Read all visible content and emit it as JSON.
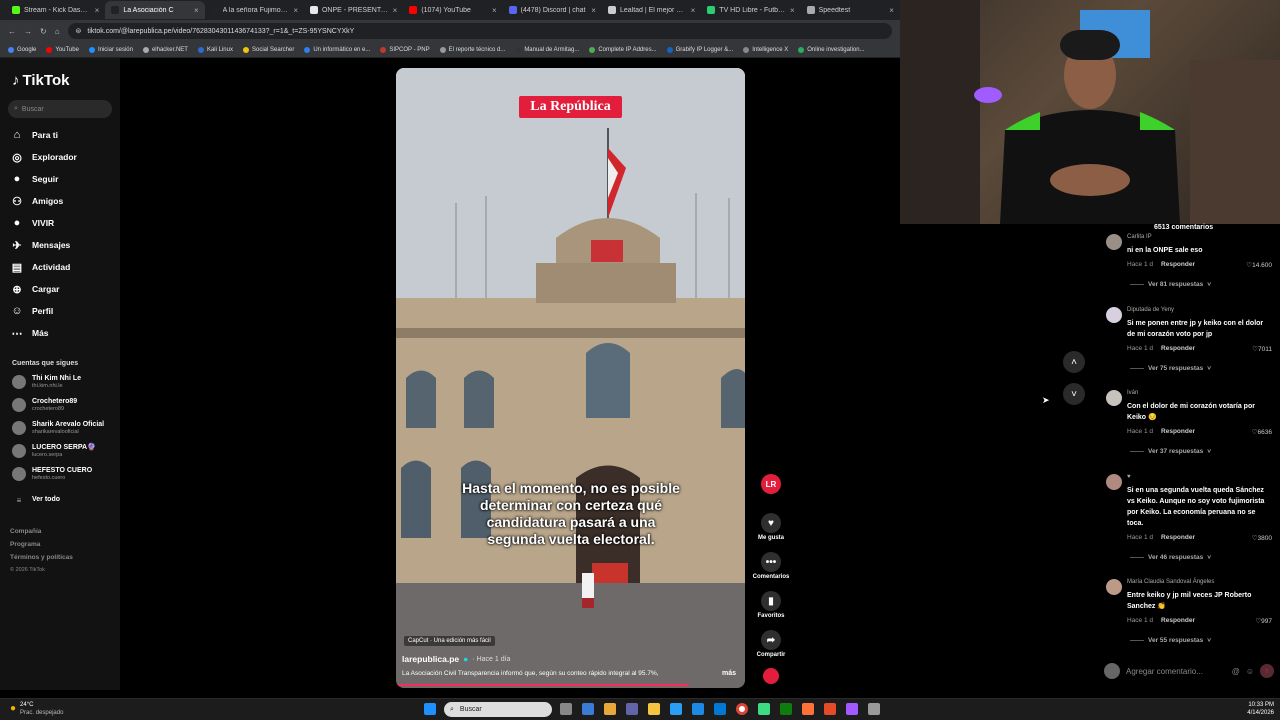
{
  "browser": {
    "tabs": [
      {
        "label": "Stream - Kick Dashboard",
        "color": "#53fc18"
      },
      {
        "label": "La Asociación C",
        "color": "#222222",
        "active": true
      },
      {
        "label": "A la señora Fujimori y al",
        "color": "#222222"
      },
      {
        "label": "ONPE - PRESENTACIÓN D",
        "color": "#e8e8e8"
      },
      {
        "label": "(1074) YouTube",
        "color": "#ff0000"
      },
      {
        "label": "(4478) Discord | chat",
        "color": "#5865f2"
      },
      {
        "label": "Lealtad | El mejor software",
        "color": "#cccccc"
      },
      {
        "label": "TV HD Libre - Futbol Libre",
        "color": "#2ecc71"
      },
      {
        "label": "Speedtest",
        "color": "#aaaaaa"
      }
    ],
    "url": "tiktok.com/@larepublica.pe/video/7628304301143674133?_r=1&_t=ZS-95YSNCYXkY",
    "bookmarks": [
      "Google",
      "YouTube",
      "Iniciar sesión",
      "elhacker.NET",
      "Kali Linux",
      "Social Searcher",
      "Un informático en e...",
      "SIPCOP - PNP",
      "El reporte técnico d...",
      "Manual de Armitag...",
      "Complete IP Addres...",
      "Grabify IP Logger &...",
      "Intelligence X",
      "Online investigation..."
    ]
  },
  "sidebar": {
    "logo": "TikTok",
    "search_placeholder": "Buscar",
    "nav": [
      {
        "label": "Para ti",
        "icon": "home-icon"
      },
      {
        "label": "Explorador",
        "icon": "compass-icon"
      },
      {
        "label": "Seguir",
        "icon": "following-icon"
      },
      {
        "label": "Amigos",
        "icon": "friends-icon"
      },
      {
        "label": "VIVIR",
        "icon": "live-icon"
      },
      {
        "label": "Mensajes",
        "icon": "messages-icon"
      },
      {
        "label": "Actividad",
        "icon": "activity-icon"
      },
      {
        "label": "Cargar",
        "icon": "upload-icon"
      },
      {
        "label": "Perfil",
        "icon": "profile-icon"
      },
      {
        "label": "Más",
        "icon": "more-icon"
      }
    ],
    "following_title": "Cuentas que sigues",
    "following": [
      {
        "name": "Thi Kim Nhi Le",
        "handle": "thi.kim.nhi.le"
      },
      {
        "name": "Crochetero89",
        "handle": "crochetero89"
      },
      {
        "name": "Sharik Arevalo Oficial",
        "handle": "sharikarevalooficial"
      },
      {
        "name": "LUCERO SERPA🔮",
        "handle": "lucero.serpa"
      },
      {
        "name": "HEFESTO CUERO",
        "handle": "hefesto.cuero"
      }
    ],
    "see_all": "Ver todo",
    "footer": [
      "Compañía",
      "Programa",
      "Términos y políticas",
      "© 2026 TikTok"
    ]
  },
  "video": {
    "brand": "La República",
    "caption": "Hasta el momento, no es posible determinar con certeza qué candidatura pasará a una segunda vuelta electoral.",
    "capcut": "CapCut · Una edición más fácil",
    "author": "larepublica.pe",
    "time": "· Hace 1 día",
    "description": "La Asociación Civil Transparencia informó que, según su conteo rápido integral al 95.7%,",
    "more": "más",
    "progress": 0.84
  },
  "actions": {
    "avatar": "LR",
    "like": "Me gusta",
    "comment": "Comentarios",
    "save": "Favoritos",
    "share": "Compartir"
  },
  "comments": {
    "count": "6513 comentarios",
    "add_placeholder": "Agregar comentario...",
    "items": [
      {
        "user": "Carlita IP",
        "text": "ni en la ONPE sale eso",
        "time": "Hace 1 d",
        "reply": "Responder",
        "likes": "14.600",
        "replies": "Ver 81 respuestas"
      },
      {
        "user": "Diputada de Yeny",
        "text": "Si me ponen entre jp y keiko con el dolor de mi corazón voto por jp",
        "time": "Hace 1 d",
        "reply": "Responder",
        "likes": "7011",
        "replies": "Ver 75 respuestas"
      },
      {
        "user": "Iván",
        "text": "Con el dolor de mi corazón votaría por Keiko 😔",
        "time": "Hace 1 d",
        "reply": "Responder",
        "likes": "6636",
        "replies": "Ver 37 respuestas"
      },
      {
        "user": "♥",
        "text": "Si en una segunda vuelta queda Sánchez vs Keiko. Aunque no soy voto fujimorista por Keiko. La economía peruana no se toca.",
        "time": "Hace 1 d",
        "reply": "Responder",
        "likes": "3800",
        "replies": "Ver 46 respuestas"
      },
      {
        "user": "María Claudia Sandoval Ángeles",
        "text": "Entre keiko y jp mil veces JP Roberto Sanchez 👏",
        "time": "Hace 1 d",
        "reply": "Responder",
        "likes": "997",
        "replies": "Ver 55 respuestas"
      }
    ]
  },
  "taskbar": {
    "weather_temp": "24°C",
    "weather_desc": "Prac. despejado",
    "search": "Buscar",
    "time": "10:33 PM",
    "date": "4/14/2026"
  }
}
